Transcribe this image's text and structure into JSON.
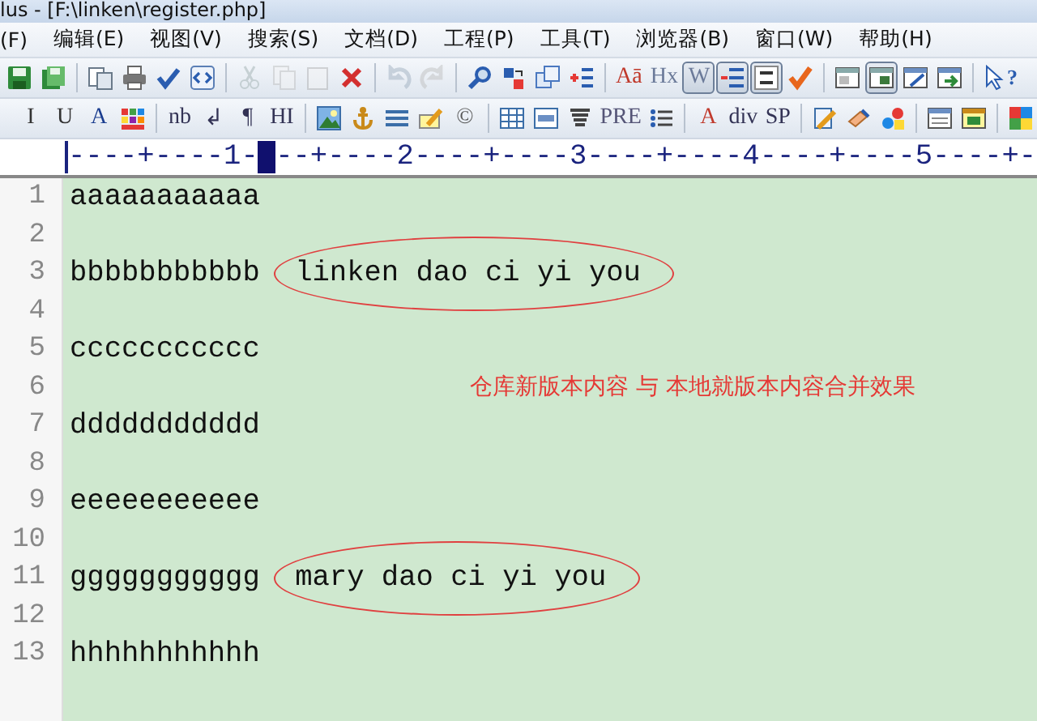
{
  "window": {
    "title": "lus - [F:\\linken\\register.php]"
  },
  "menu": [
    "(F)",
    "编辑(E)",
    "视图(V)",
    "搜索(S)",
    "文档(D)",
    "工程(P)",
    "工具(T)",
    "浏览器(B)",
    "窗口(W)",
    "帮助(H)"
  ],
  "toolbar_1": [
    {
      "kind": "icon"
    },
    {
      "kind": "icon"
    },
    {
      "kind": "separator"
    },
    {
      "kind": "icon"
    },
    {
      "kind": "icon"
    },
    {
      "kind": "icon"
    },
    {
      "kind": "icon"
    },
    {
      "kind": "separator"
    },
    {
      "kind": "icon",
      "disabled": true
    },
    {
      "kind": "icon",
      "disabled": true
    },
    {
      "kind": "icon",
      "disabled": true
    },
    {
      "kind": "icon"
    },
    {
      "kind": "separator"
    },
    {
      "kind": "icon",
      "disabled": true
    },
    {
      "kind": "icon",
      "disabled": true
    },
    {
      "kind": "separator"
    },
    {
      "kind": "icon"
    },
    {
      "kind": "icon"
    },
    {
      "kind": "icon"
    },
    {
      "kind": "icon"
    },
    {
      "kind": "separator"
    },
    {
      "kind": "text",
      "label": "Aā",
      "color": "#c0392b"
    },
    {
      "kind": "text",
      "label": "Hx",
      "color": "#6b7a99"
    },
    {
      "kind": "text",
      "label": "W",
      "color": "#6b7a99",
      "selected": true
    },
    {
      "kind": "icon",
      "selected": true
    },
    {
      "kind": "icon",
      "selected": true
    },
    {
      "kind": "icon"
    },
    {
      "kind": "separator"
    },
    {
      "kind": "icon"
    },
    {
      "kind": "icon",
      "selected": true
    },
    {
      "kind": "icon"
    },
    {
      "kind": "icon"
    },
    {
      "kind": "separator"
    },
    {
      "kind": "icon",
      "label": "?"
    }
  ],
  "toolbar_2": [
    {
      "kind": "text",
      "label": "I",
      "color": "#333333"
    },
    {
      "kind": "text",
      "label": "U",
      "color": "#333333"
    },
    {
      "kind": "text",
      "label": "A",
      "color": "#1a3d8f"
    },
    {
      "kind": "icon"
    },
    {
      "kind": "separator"
    },
    {
      "kind": "text",
      "label": "nb",
      "color": "#333355"
    },
    {
      "kind": "text",
      "label": "↲",
      "color": "#333355"
    },
    {
      "kind": "text",
      "label": "¶",
      "color": "#333355"
    },
    {
      "kind": "text",
      "label": "HI",
      "color": "#333355"
    },
    {
      "kind": "separator"
    },
    {
      "kind": "icon"
    },
    {
      "kind": "icon"
    },
    {
      "kind": "icon"
    },
    {
      "kind": "icon"
    },
    {
      "kind": "text",
      "label": "©",
      "color": "#555555"
    },
    {
      "kind": "separator"
    },
    {
      "kind": "icon"
    },
    {
      "kind": "icon"
    },
    {
      "kind": "icon"
    },
    {
      "kind": "text",
      "label": "PRE",
      "color": "#555577"
    },
    {
      "kind": "icon"
    },
    {
      "kind": "separator"
    },
    {
      "kind": "text",
      "label": "A",
      "color": "#c0392b"
    },
    {
      "kind": "text",
      "label": "div",
      "color": "#333355"
    },
    {
      "kind": "text",
      "label": "SP",
      "color": "#333355"
    },
    {
      "kind": "separator"
    },
    {
      "kind": "icon"
    },
    {
      "kind": "icon"
    },
    {
      "kind": "icon"
    },
    {
      "kind": "separator"
    },
    {
      "kind": "icon"
    },
    {
      "kind": "icon"
    },
    {
      "kind": "separator"
    },
    {
      "kind": "icon"
    }
  ],
  "ruler": {
    "before": "----+----1-",
    "after": "--+----2----+----3----+----4----+----5----+-"
  },
  "lines": [
    {
      "number": "1",
      "text": "aaaaaaaaaaa"
    },
    {
      "number": "2"
    },
    {
      "number": "3",
      "text": "bbbbbbbbbbb",
      "circled": "linken dao ci yi you"
    },
    {
      "number": "4"
    },
    {
      "number": "5",
      "text": "ccccccccccc"
    },
    {
      "number": "6"
    },
    {
      "number": "7",
      "text": "ddddddddddd"
    },
    {
      "number": "8"
    },
    {
      "number": "9",
      "text": "eeeeeeeeeee"
    },
    {
      "number": "10"
    },
    {
      "number": "11",
      "text": "ggggggggggg",
      "circled": "mary dao ci yi you"
    },
    {
      "number": "12"
    },
    {
      "number": "13",
      "text": "hhhhhhhhhhh"
    }
  ],
  "annotation": "仓库新版本内容 与 本地就版本内容合并效果"
}
